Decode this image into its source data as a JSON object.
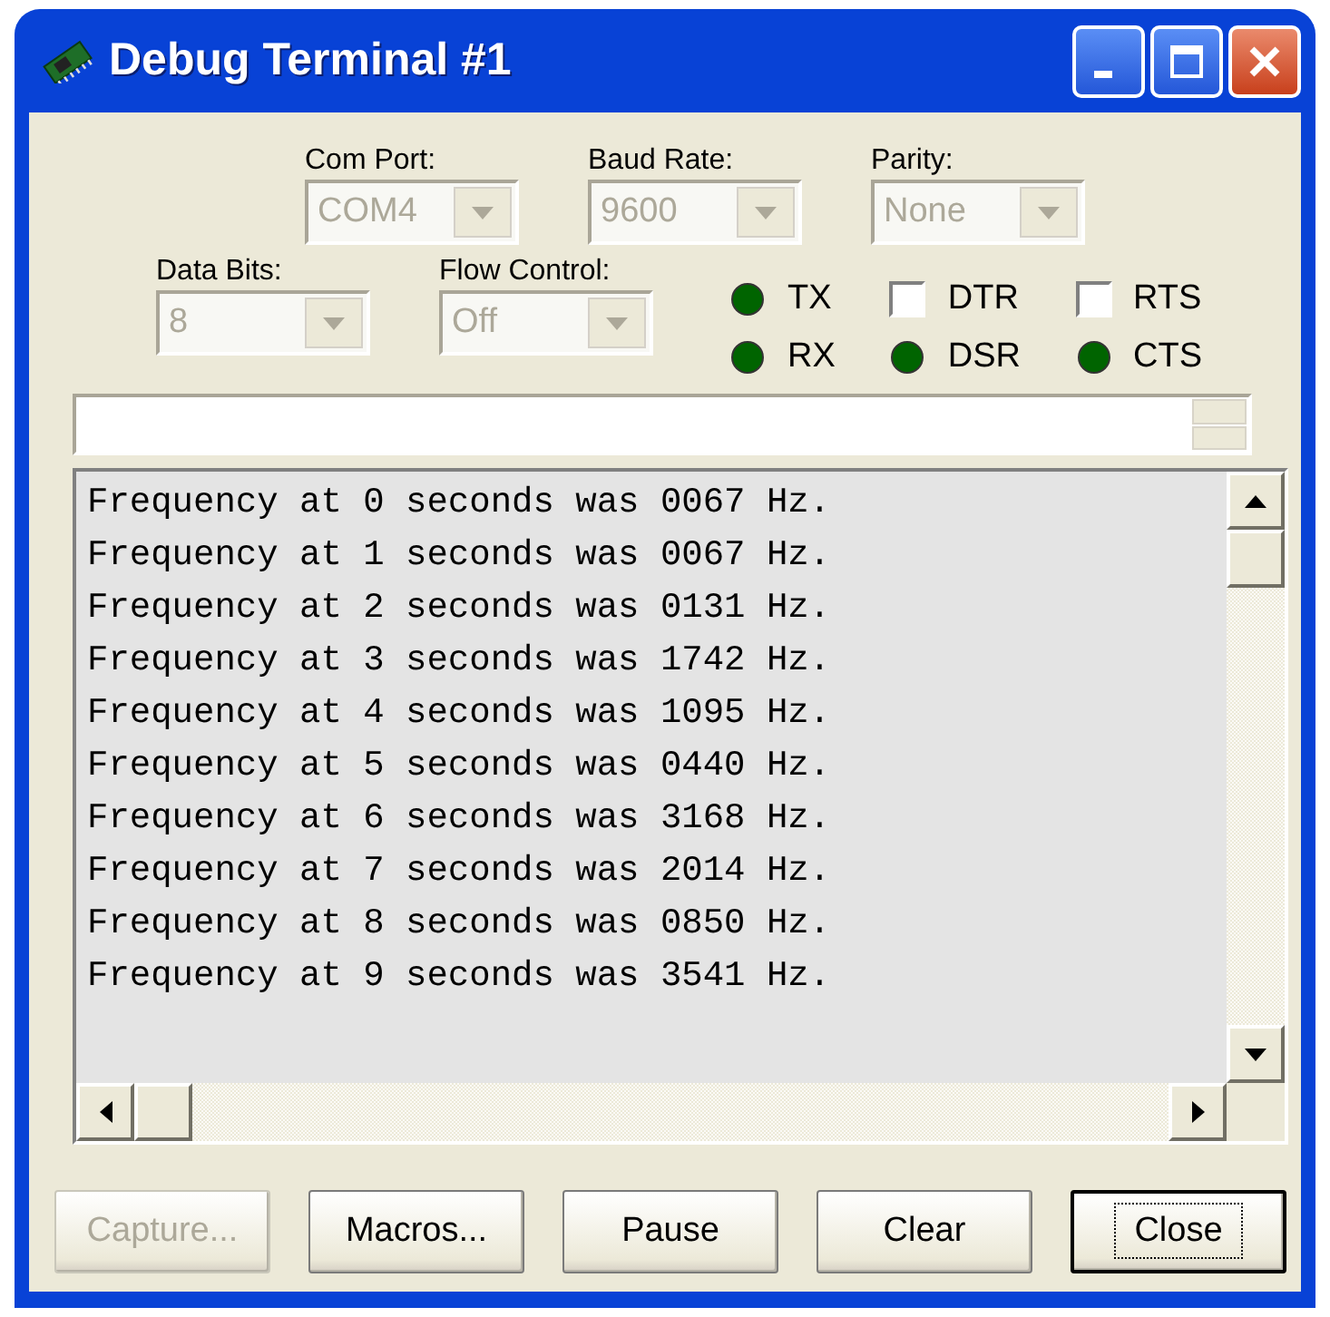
{
  "window": {
    "title": "Debug Terminal #1"
  },
  "settings": [
    {
      "label": "Com Port:",
      "value": "COM4",
      "disabled": true
    },
    {
      "label": "Baud Rate:",
      "value": "9600",
      "disabled": true
    },
    {
      "label": "Parity:",
      "value": "None",
      "disabled": true
    },
    {
      "label": "Data Bits:",
      "value": "8",
      "disabled": true
    },
    {
      "label": "Flow Control:",
      "value": "Off",
      "disabled": true
    }
  ],
  "signals": [
    {
      "kind": "led",
      "label": "TX",
      "on": true
    },
    {
      "kind": "checkbox",
      "label": "DTR",
      "checked": false
    },
    {
      "kind": "checkbox",
      "label": "RTS",
      "checked": false
    },
    {
      "kind": "led",
      "label": "RX",
      "on": true
    },
    {
      "kind": "led",
      "label": "DSR",
      "on": true
    },
    {
      "kind": "led",
      "label": "CTS",
      "on": true
    }
  ],
  "output": {
    "lines": [
      "Frequency at 0 seconds was 0067 Hz.",
      "Frequency at 1 seconds was 0067 Hz.",
      "Frequency at 2 seconds was 0131 Hz.",
      "Frequency at 3 seconds was 1742 Hz.",
      "Frequency at 4 seconds was 1095 Hz.",
      "Frequency at 5 seconds was 0440 Hz.",
      "Frequency at 6 seconds was 3168 Hz.",
      "Frequency at 7 seconds was 2014 Hz.",
      "Frequency at 8 seconds was 0850 Hz.",
      "Frequency at 9 seconds was 3541 Hz."
    ]
  },
  "buttons": [
    {
      "label": "Capture...",
      "disabled": true,
      "default": false
    },
    {
      "label": "Macros...",
      "disabled": false,
      "default": false
    },
    {
      "label": "Pause",
      "disabled": false,
      "default": false
    },
    {
      "label": "Clear",
      "disabled": false,
      "default": false
    },
    {
      "label": "Close",
      "disabled": false,
      "default": true
    }
  ]
}
